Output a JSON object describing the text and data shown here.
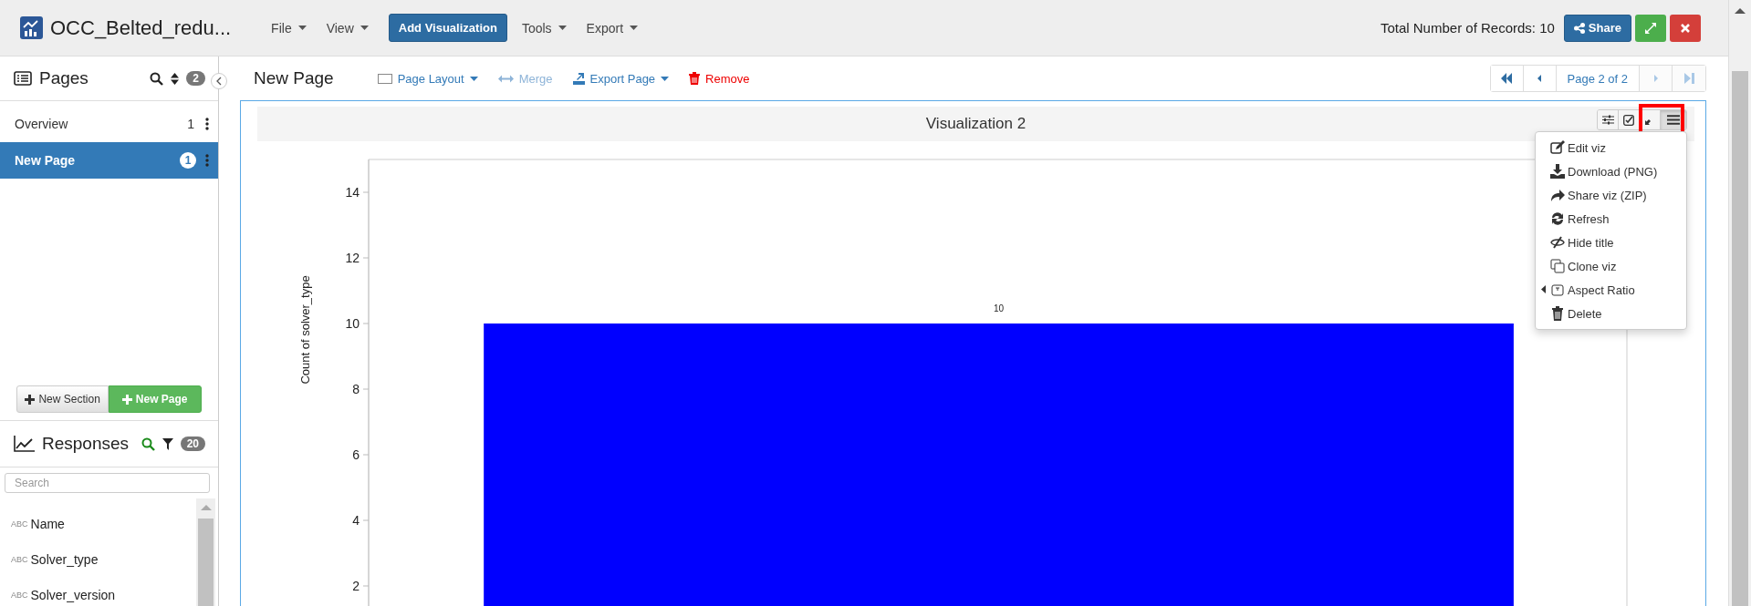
{
  "app": {
    "title": "OCC_Belted_redu...",
    "menus": [
      {
        "label": "File",
        "kind": "menu"
      },
      {
        "label": "View",
        "kind": "menu"
      },
      {
        "label": "Add Visualization",
        "kind": "button"
      },
      {
        "label": "Tools",
        "kind": "menu"
      },
      {
        "label": "Export",
        "kind": "menu"
      }
    ],
    "records": "Total Number of Records: 10",
    "share": "Share"
  },
  "pages_panel": {
    "title": "Pages",
    "count": "2",
    "items": [
      {
        "label": "Overview",
        "count": "1",
        "selected": false
      },
      {
        "label": "New Page",
        "count": "1",
        "selected": true
      }
    ],
    "buttons": [
      {
        "label": "New Section",
        "kind": "default"
      },
      {
        "label": "New Page",
        "kind": "primary"
      }
    ]
  },
  "responses_panel": {
    "title": "Responses",
    "count": "20",
    "placeholder": "Search",
    "fields": [
      {
        "type": "ABC",
        "name": "Name"
      },
      {
        "type": "ABC",
        "name": "Solver_type"
      },
      {
        "type": "ABC",
        "name": "Solver_version"
      }
    ]
  },
  "page": {
    "title": "New Page",
    "actions": [
      {
        "label": "Page Layout",
        "kind": "layout",
        "disabled": false
      },
      {
        "label": "Merge",
        "kind": "merge",
        "disabled": true
      },
      {
        "label": "Export Page",
        "kind": "export",
        "disabled": false
      },
      {
        "label": "Remove",
        "kind": "remove",
        "disabled": false
      }
    ],
    "pager": {
      "label": "Page 2 of 2",
      "buttons": [
        {
          "kind": "first",
          "disabled": false
        },
        {
          "kind": "prev",
          "disabled": false
        },
        {
          "kind": "next",
          "disabled": true
        },
        {
          "kind": "last",
          "disabled": true
        }
      ]
    }
  },
  "visualization": {
    "title": "Visualization 2",
    "menu": [
      {
        "label": "Edit viz",
        "kind": "edit",
        "submenu": false
      },
      {
        "label": "Download (PNG)",
        "kind": "download",
        "submenu": false
      },
      {
        "label": "Share viz (ZIP)",
        "kind": "share",
        "submenu": false
      },
      {
        "label": "Refresh",
        "kind": "refresh",
        "submenu": false
      },
      {
        "label": "Hide title",
        "kind": "hide",
        "submenu": false
      },
      {
        "label": "Clone viz",
        "kind": "clone",
        "submenu": false
      },
      {
        "label": "Aspect Ratio",
        "kind": "aspect",
        "submenu": true
      },
      {
        "label": "Delete",
        "kind": "delete",
        "submenu": false
      }
    ],
    "chart_data": {
      "type": "bar",
      "ylabel": "Count of solver_type",
      "ylim": [
        0,
        15
      ],
      "yticks": [
        2,
        4,
        6,
        8,
        10,
        12,
        14
      ],
      "data_labels": true,
      "values": [
        10
      ]
    }
  }
}
